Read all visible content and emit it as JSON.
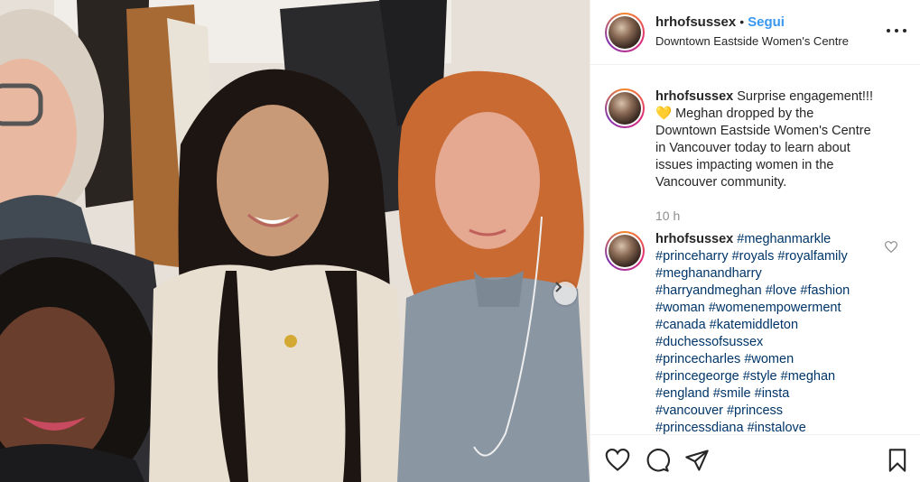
{
  "post": {
    "username": "hrhofsussex",
    "separator": "•",
    "follow_label": "Segui",
    "location": "Downtown Eastside Women's Centre"
  },
  "caption": {
    "username": "hrhofsussex",
    "text_lines": [
      "Surprise engagement!!!",
      "💛 Meghan dropped by the",
      "Downtown Eastside Women's Centre",
      "in Vancouver today to learn about",
      "issues impacting women in the",
      "Vancouver community."
    ],
    "time": "10 h"
  },
  "hashtag_comment": {
    "username": "hrhofsussex",
    "lines": [
      "#meghanmarkle",
      "#princeharry #royals #royalfamily",
      "#meghanandharry",
      "#harryandmeghan #love #fashion",
      "#woman #womenempowerment",
      "#canada #katemiddleton",
      "#duchessofsussex",
      "#princecharles #women",
      "#princegeorge #style #meghan",
      "#england #smile #insta",
      "#vancouver #princess",
      "#princessdiana #instalove"
    ]
  },
  "colors": {
    "accent": "#3897f0",
    "hashtag": "#003569",
    "muted": "#8e8e8e",
    "text": "#262626"
  },
  "icons": {
    "more": "more-horizontal-icon",
    "like": "heart-icon",
    "comment": "comment-bubble-icon",
    "share": "paper-plane-icon",
    "save": "bookmark-icon",
    "carousel": "chevron-right-icon"
  }
}
